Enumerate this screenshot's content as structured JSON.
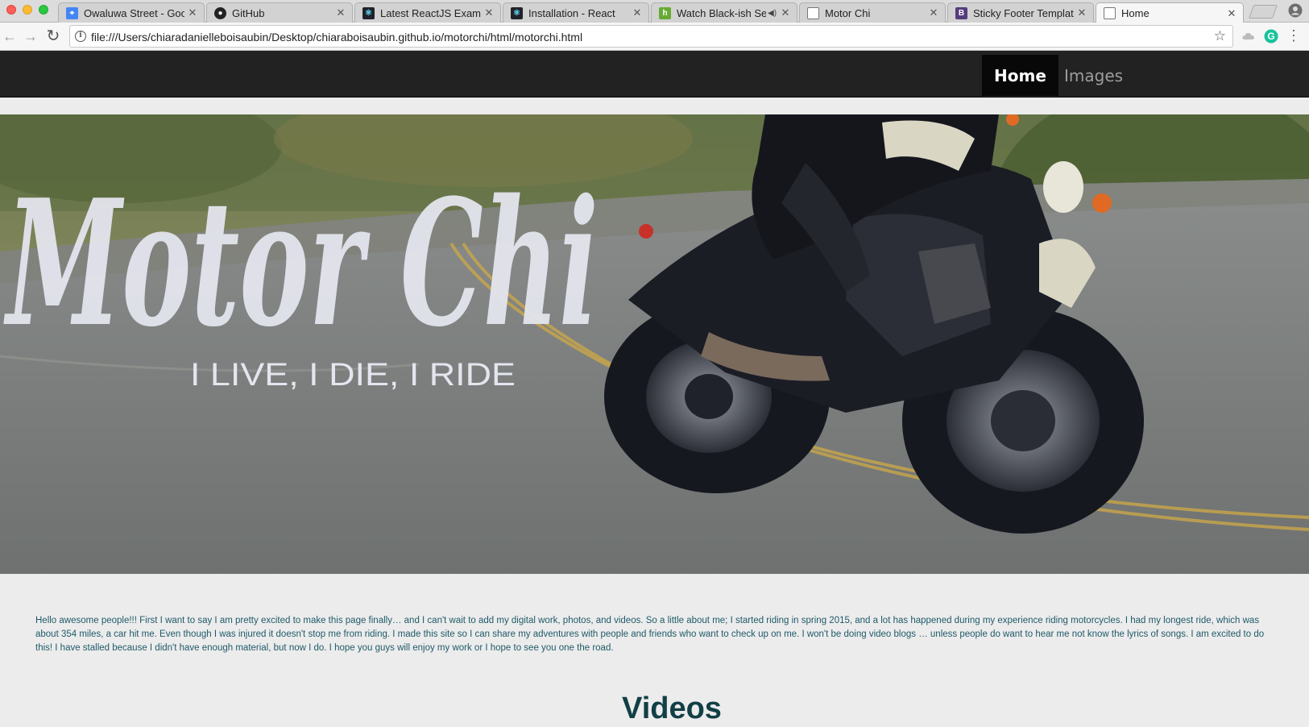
{
  "browser": {
    "tabs": [
      {
        "title": "Owaluwa Street - Goog",
        "favicon": "maps-icon",
        "color": "#34a853"
      },
      {
        "title": "GitHub",
        "favicon": "github-icon",
        "color": "#222222"
      },
      {
        "title": "Latest ReactJS Exampl",
        "favicon": "react-icon",
        "color": "#20232a"
      },
      {
        "title": "Installation - React",
        "favicon": "react-icon",
        "color": "#20232a"
      },
      {
        "title": "Watch Black-ish Se",
        "favicon": "hulu-icon",
        "color": "#66aa33"
      },
      {
        "title": "Motor Chi",
        "favicon": "page-icon",
        "color": "#ffffff"
      },
      {
        "title": "Sticky Footer Template",
        "favicon": "bootstrap-icon",
        "color": "#563d7c"
      },
      {
        "title": "Home",
        "favicon": "page-icon",
        "color": "#ffffff"
      }
    ],
    "url": "file:///Users/chiaradanielleboisaubin/Desktop/chiaraboisaubin.github.io/motorchi/html/motorchi.html"
  },
  "site": {
    "nav": {
      "home": "Home",
      "images": "Images"
    },
    "hero": {
      "logo_text": "Motor Chi",
      "tagline": "I LIVE, I DIE, I RIDE"
    },
    "intro": "Hello awesome people!!! First I want to say I am pretty excited to make this page finally… and I can't wait to add my digital work, photos, and videos. So a little about me; I started riding in spring 2015, and a lot has happened during my experience riding motorcycles. I had my longest ride, which was about 354 miles, a car hit me. Even though I was injured it doesn't stop me from riding. I made this site so I can share my adventures with people and friends who want to check up on me. I won't be doing video blogs … unless people do want to hear me not know the lyrics of songs. I am excited to do this! I have stalled because I didn't have enough material, but now I do. I hope you guys will enjoy my work or I hope to see you one the road.",
    "videos_heading": "Videos"
  }
}
